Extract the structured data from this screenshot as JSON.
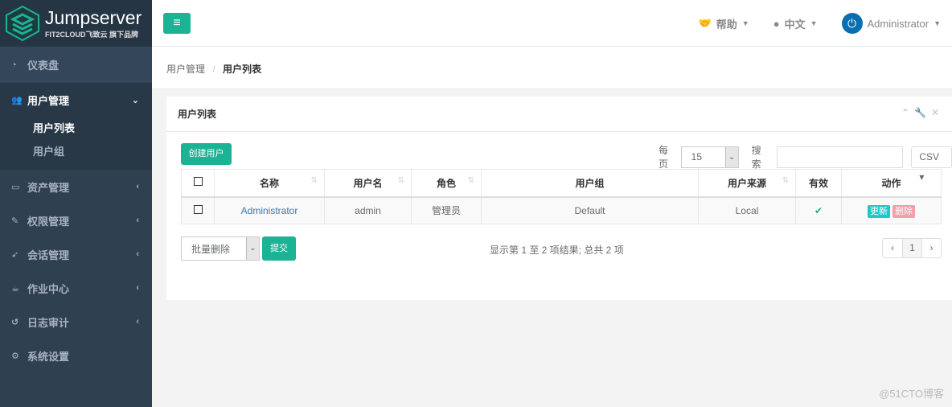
{
  "logo": {
    "title": "Jumpserver",
    "subtitle": "FIT2CLOUD飞致云 旗下品牌"
  },
  "sidebar": {
    "items": [
      {
        "label": "仪表盘",
        "icon": "dashboard-icon"
      },
      {
        "label": "用户管理",
        "icon": "users-icon",
        "children": [
          {
            "label": "用户列表"
          },
          {
            "label": "用户组"
          }
        ]
      },
      {
        "label": "资产管理",
        "icon": "inbox-icon"
      },
      {
        "label": "权限管理",
        "icon": "edit-icon"
      },
      {
        "label": "会话管理",
        "icon": "rocket-icon"
      },
      {
        "label": "作业中心",
        "icon": "coffee-icon"
      },
      {
        "label": "日志审计",
        "icon": "history-icon"
      },
      {
        "label": "系统设置",
        "icon": "gears-icon"
      }
    ]
  },
  "topbar": {
    "help": "帮助",
    "lang": "中文",
    "user": "Administrator"
  },
  "breadcrumb": {
    "parent": "用户管理",
    "current": "用户列表"
  },
  "panel": {
    "title": "用户列表",
    "create": "创建用户",
    "per_page_label": "每页",
    "per_page": "15",
    "search_label": "搜索",
    "search_value": "",
    "csv": "CSV",
    "columns": [
      "名称",
      "用户名",
      "角色",
      "用户组",
      "用户来源",
      "有效",
      "动作"
    ],
    "rows": [
      {
        "name": "Administrator",
        "username": "admin",
        "role": "管理员",
        "group": "Default",
        "source": "Local",
        "active": true,
        "update": "更新",
        "delete": "删除"
      }
    ],
    "bulk_action": "批量删除",
    "submit": "提交",
    "info": "显示第 1 至 2 项结果; 总共 2 项",
    "page": "1",
    "prev": "‹",
    "next": "›"
  },
  "watermark": "@51CTO博客",
  "colors": {
    "accent": "#1ab394",
    "sidebar": "#2f4050",
    "link": "#337ab7",
    "update": "#23c6c8",
    "delete": "#ed5565"
  }
}
